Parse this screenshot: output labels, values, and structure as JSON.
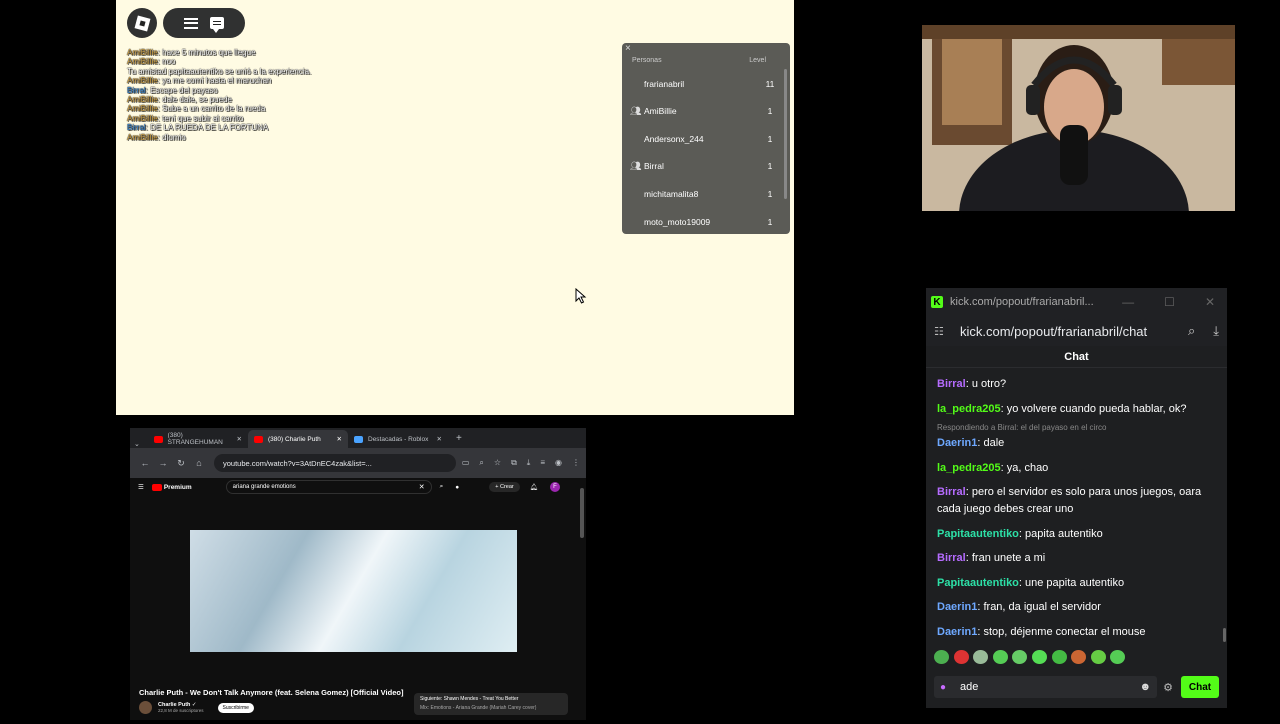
{
  "game": {
    "chat": [
      {
        "user": "AmiBillie",
        "color": "#d6a84a",
        "text": "hace 5 minutos que llegue"
      },
      {
        "user": "AmiBillie",
        "color": "#d6a84a",
        "text": "noo"
      },
      {
        "user": "",
        "color": "",
        "text": "Tu amistad papitaautentiko se unió a la experiencia."
      },
      {
        "user": "AmiBillie",
        "color": "#d6a84a",
        "text": "ya me comí hasta el maruchan"
      },
      {
        "user": "Birral",
        "color": "#3c8fde",
        "text": "Escape del payaso"
      },
      {
        "user": "AmiBillie",
        "color": "#d6a84a",
        "text": "dale dale, se puede"
      },
      {
        "user": "AmiBillie",
        "color": "#d6a84a",
        "text": "Sube a un carrito de la rueda"
      },
      {
        "user": "AmiBillie",
        "color": "#d6a84a",
        "text": "tení que subir al carrito"
      },
      {
        "user": "Birral",
        "color": "#3c8fde",
        "text": "DE LA RUEDA DE LA FORTUNA"
      },
      {
        "user": "AmiBillie",
        "color": "#d6a84a",
        "text": "dlomio"
      }
    ],
    "players": {
      "close": "×",
      "header_people": "Personas",
      "header_level": "Level",
      "rows": [
        {
          "name": "frarianabril",
          "level": "11",
          "friend": false
        },
        {
          "name": "AmiBillie",
          "level": "1",
          "friend": true
        },
        {
          "name": "Andersonx_244",
          "level": "1",
          "friend": false
        },
        {
          "name": "Birral",
          "level": "1",
          "friend": true
        },
        {
          "name": "michitamalita8",
          "level": "1",
          "friend": false
        },
        {
          "name": "moto_moto19009",
          "level": "1",
          "friend": false
        }
      ]
    }
  },
  "kick": {
    "window_title": "kick.com/popout/frarianabril...",
    "url": "kick.com/popout/frarianabril/chat",
    "chat_header": "Chat",
    "messages": [
      {
        "user": "Birral",
        "color": "#b66cff",
        "text": ": u otro?"
      },
      {
        "user": "la_pedra205",
        "color": "#53fc18",
        "text": ": yo volvere cuando pueda hablar, ok?"
      },
      {
        "reply": "Respondiendo a Birral: el del payaso en el circo",
        "user": "Daerin1",
        "color": "#6ea8ff",
        "text": ": dale"
      },
      {
        "user": "la_pedra205",
        "color": "#53fc18",
        "text": ": ya, chao"
      },
      {
        "user": "Birral",
        "color": "#b66cff",
        "text": ": pero el servidor es solo para unos juegos, oara cada juego debes crear uno"
      },
      {
        "user": "Papitaautentiko",
        "color": "#2de0a7",
        "text": ": papita autentiko"
      },
      {
        "user": "Birral",
        "color": "#b66cff",
        "text": ": fran unete a mi"
      },
      {
        "user": "Papitaautentiko",
        "color": "#2de0a7",
        "text": ": une papita autentiko"
      },
      {
        "user": "Daerin1",
        "color": "#6ea8ff",
        "text": ": fran, da igual el servidor"
      },
      {
        "user": "Daerin1",
        "color": "#6ea8ff",
        "text": ": stop, déjenme conectar el mouse"
      }
    ],
    "input_value": "ade",
    "send_label": "Chat",
    "accent": "#53fc18"
  },
  "browser": {
    "tabs": [
      {
        "label": "(380) STRANGEHUMAN",
        "type": "yt"
      },
      {
        "label": "(380) Charlie Puth",
        "type": "yt"
      },
      {
        "label": "Destacadas - Roblox",
        "type": "rb"
      }
    ],
    "url": "youtube.com/watch?v=3AtDnEC4zak&list=...",
    "yt_brand": "Premium",
    "search_value": "ariana grande emotions",
    "create_label": "+ Crear",
    "avatar_letter": "F",
    "video_title": "Charlie Puth - We Don't Talk Anymore (feat. Selena Gomez) [Official Video]",
    "channel_name": "Charlie Puth ✓",
    "channel_subs": "22,8 M de suscriptores",
    "subscribe_label": "Suscribirme",
    "next_label": "Siguiente: Shawn Mendes - Treat You Better",
    "next_sub": "Mix: Emotions - Ariana Grande (Mariah Carey cover)"
  }
}
